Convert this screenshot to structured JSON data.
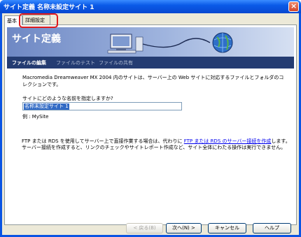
{
  "window": {
    "title": "サイト定義 名称未設定サイト 1",
    "close_label": "×"
  },
  "tabs": {
    "basic": "基本",
    "advanced": "詳細設定"
  },
  "banner": {
    "title": "サイト定義"
  },
  "nav": {
    "item1": "ファイルの編集",
    "item2": "ファイルのテスト",
    "item3": "ファイルの共有"
  },
  "content": {
    "intro": "Macromedia Dreamweaver MX 2004 内のサイトは、サーバー上の Web サイトに対応するファイルとフォルダのコレクションです。",
    "question": "サイトにどのような名前を指定しますか?",
    "site_name_value": "名称未設定サイト 1",
    "example": "例 : MySite",
    "ftp_text_before": "FTP または RDS を使用してサーバー上で直接作業する場合は、代わりに ",
    "ftp_link": "FTP または RDS のサーバー接続を作成",
    "ftp_text_after": "します。サーバー接続を作成すると、リンクのチェックやサイトレポート作成など、サイト全体にわたる操作は実行できません。"
  },
  "buttons": {
    "back": "< 戻る(B)",
    "next": "次へ(N) >",
    "cancel": "キャンセル",
    "help": "ヘルプ"
  },
  "colors": {
    "highlight": "#e0191b",
    "titlebar": "#0a54e3",
    "navbar": "#243c72",
    "link": "#0000ee"
  }
}
